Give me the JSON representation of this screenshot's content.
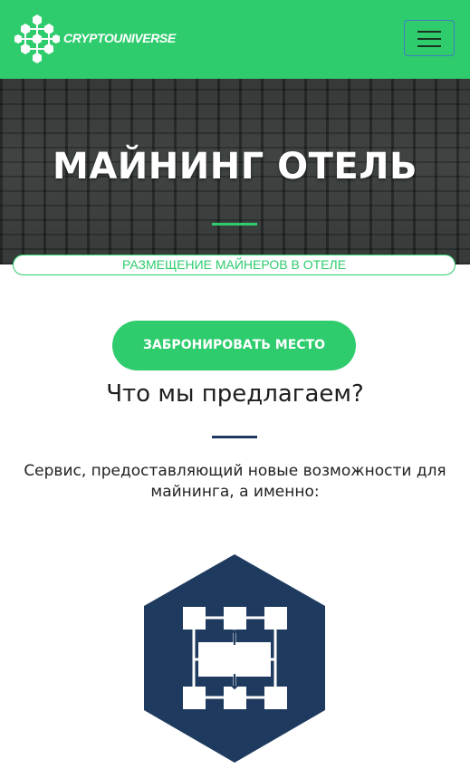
{
  "header": {
    "brand": "CRYPTOUNIVERSE",
    "logo_icon": "hexagon-cluster-icon",
    "menu_icon": "hamburger-menu-icon"
  },
  "hero": {
    "title": "МАЙНИНГ ОТЕЛЬ",
    "subtitle": "РАЗМЕЩЕНИЕ МАЙНЕРОВ В ОТЕЛЕ"
  },
  "cta": {
    "label": "ЗАБРОНИРОВАТЬ МЕСТО"
  },
  "offer": {
    "title": "Что мы предлагаем?",
    "text": "Сервис, предоставляющий новые возможности для майнинга, а именно:",
    "icon": "network-hub-icon"
  },
  "colors": {
    "brand_green": "#2ecc6d",
    "navy": "#1e3a5f",
    "white": "#ffffff"
  }
}
